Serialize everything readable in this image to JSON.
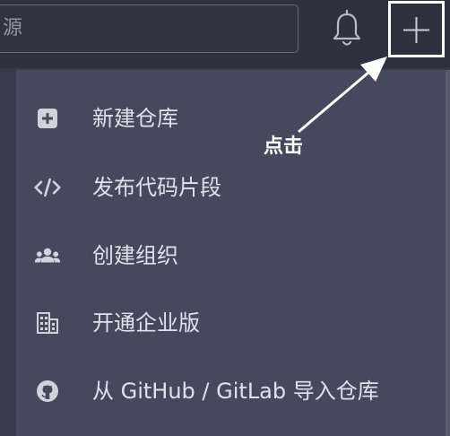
{
  "header": {
    "search_text": "源"
  },
  "menu": {
    "items": [
      {
        "label": "新建仓库",
        "icon": "plus-square-icon"
      },
      {
        "label": "发布代码片段",
        "icon": "code-icon"
      },
      {
        "label": "创建组织",
        "icon": "people-icon"
      },
      {
        "label": "开通企业版",
        "icon": "building-icon"
      },
      {
        "label": "从 GitHub / GitLab 导入仓库",
        "icon": "github-icon"
      }
    ]
  },
  "annotation": {
    "text": "点击"
  },
  "colors": {
    "topbar": "#2d323e",
    "dropdown": "#444a5c",
    "menu_text": "#dfe2e8",
    "icon": "#cfd3da",
    "highlight": "#ffffff"
  }
}
